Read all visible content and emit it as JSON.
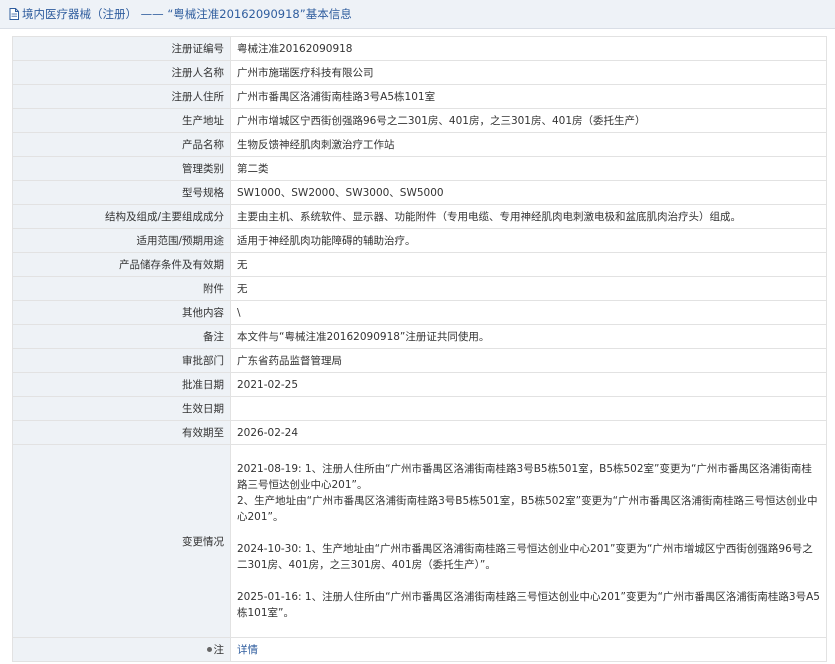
{
  "header": {
    "breadcrumb_prefix": "境内医疗器械（注册）",
    "separator": "——",
    "title_suffix": "“粤械注准20162090918”基本信息"
  },
  "rows": [
    {
      "label": "注册证编号",
      "value": "粤械注准20162090918"
    },
    {
      "label": "注册人名称",
      "value": "广州市施瑞医疗科技有限公司"
    },
    {
      "label": "注册人住所",
      "value": "广州市番禺区洛浦街南桂路3号A5栋101室"
    },
    {
      "label": "生产地址",
      "value": "广州市增城区宁西街创强路96号之二301房、401房，之三301房、401房（委托生产）"
    },
    {
      "label": "产品名称",
      "value": "生物反馈神经肌肉刺激治疗工作站"
    },
    {
      "label": "管理类别",
      "value": "第二类"
    },
    {
      "label": "型号规格",
      "value": "SW1000、SW2000、SW3000、SW5000"
    },
    {
      "label": "结构及组成/主要组成成分",
      "value": "主要由主机、系统软件、显示器、功能附件（专用电缆、专用神经肌肉电刺激电极和盆底肌肉治疗头）组成。"
    },
    {
      "label": "适用范围/预期用途",
      "value": "适用于神经肌肉功能障碍的辅助治疗。"
    },
    {
      "label": "产品储存条件及有效期",
      "value": "无"
    },
    {
      "label": "附件",
      "value": "无"
    },
    {
      "label": "其他内容",
      "value": "\\"
    },
    {
      "label": "备注",
      "value": "本文件与“粤械注准20162090918”注册证共同使用。"
    },
    {
      "label": "审批部门",
      "value": "广东省药品监督管理局"
    },
    {
      "label": "批准日期",
      "value": "2021-02-25"
    },
    {
      "label": "生效日期",
      "value": ""
    },
    {
      "label": "有效期至",
      "value": "2026-02-24"
    }
  ],
  "change": {
    "label": "变更情况",
    "entries": [
      "2021-08-19: 1、注册人住所由“广州市番禺区洛浦街南桂路3号B5栋501室，B5栋502室”变更为“广州市番禺区洛浦街南桂路三号恒达创业中心201”。",
      "2、生产地址由“广州市番禺区洛浦街南桂路3号B5栋501室，B5栋502室”变更为“广州市番禺区洛浦街南桂路三号恒达创业中心201”。",
      "2024-10-30: 1、生产地址由“广州市番禺区洛浦街南桂路三号恒达创业中心201”变更为“广州市增城区宁西街创强路96号之二301房、401房，之三301房、401房（委托生产）”。",
      "2025-01-16: 1、注册人住所由“广州市番禺区洛浦街南桂路三号恒达创业中心201”变更为“广州市番禺区洛浦街南桂路3号A5栋101室”。"
    ]
  },
  "note": {
    "label": "注",
    "link": "详情"
  }
}
